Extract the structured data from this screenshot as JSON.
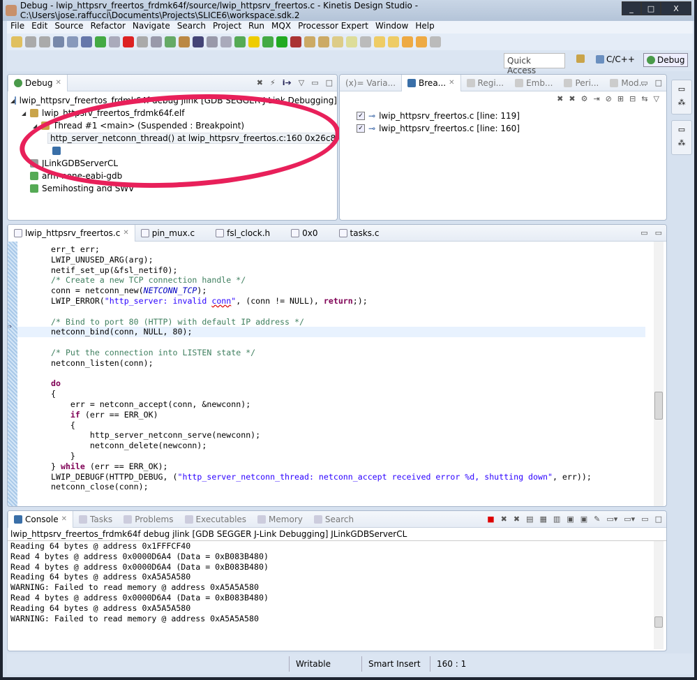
{
  "window": {
    "title": "Debug - lwip_httpsrv_freertos_frdmk64f/source/lwip_httpsrv_freertos.c - Kinetis Design Studio - C:\\Users\\jose.raffucci\\Documents\\Projects\\SLICE6\\workspace.sdk.2",
    "minimize": "_",
    "maximize": "□",
    "close": "X"
  },
  "menu": [
    "File",
    "Edit",
    "Source",
    "Refactor",
    "Navigate",
    "Search",
    "Project",
    "Run",
    "MQX",
    "Processor Expert",
    "Window",
    "Help"
  ],
  "quick_access": "Quick Access",
  "perspectives": {
    "cpp": "C/C++",
    "debug": "Debug"
  },
  "debug_view": {
    "tab": "Debug",
    "tree": [
      "lwip_httpsrv_freertos_frdmk64f debug jlink [GDB SEGGER J-Link Debugging]",
      "lwip_httpsrv_freertos_frdmk64f.elf",
      "Thread #1 <main> (Suspended : Breakpoint)",
      "http_server_netconn_thread() at lwip_httpsrv_freertos.c:160 0x26c8",
      "",
      "JLinkGDBServerCL",
      "arm-none-eabi-gdb",
      "Semihosting and SWV"
    ]
  },
  "right_view": {
    "tabs": [
      "(x)= Varia...",
      "Brea...",
      "Regi...",
      "Emb...",
      "Peri...",
      "Mod..."
    ],
    "breakpoints": [
      {
        "label": "lwip_httpsrv_freertos.c [line: 119]",
        "checked": true
      },
      {
        "label": "lwip_httpsrv_freertos.c [line: 160]",
        "checked": true
      }
    ]
  },
  "editor": {
    "tabs": [
      "lwip_httpsrv_freertos.c",
      "pin_mux.c",
      "fsl_clock.h",
      "0x0",
      "tasks.c"
    ],
    "current_line": 9,
    "lines": [
      [
        [
          "p",
          "err_t err;"
        ]
      ],
      [
        [
          "p",
          "LWIP_UNUSED_ARG(arg);"
        ]
      ],
      [
        [
          "p",
          "netif_set_up(&fsl_netif0);"
        ]
      ],
      [
        [
          "c",
          "/* Create a new TCP connection handle */"
        ]
      ],
      [
        [
          "p",
          "conn = netconn_new("
        ],
        [
          "n",
          "NETCONN_TCP"
        ],
        [
          "p",
          ");"
        ]
      ],
      [
        [
          "p",
          "LWIP_ERROR("
        ],
        [
          "s",
          "\"http_server: invalid "
        ],
        [
          "su",
          "conn"
        ],
        [
          "s",
          "\""
        ],
        [
          "p",
          ", (conn != NULL), "
        ],
        [
          "k",
          "return"
        ],
        [
          "p",
          ";);"
        ]
      ],
      [],
      [
        [
          "c",
          "/* Bind to port 80 (HTTP) with default IP address */"
        ]
      ],
      [
        [
          "p",
          "netconn_bind(conn, NULL, 80);"
        ]
      ],
      [],
      [
        [
          "c",
          "/* Put the connection into LISTEN state */"
        ]
      ],
      [
        [
          "p",
          "netconn_listen(conn);"
        ]
      ],
      [],
      [
        [
          "k",
          "do"
        ]
      ],
      [
        [
          "p",
          "{"
        ]
      ],
      [
        [
          "p",
          "    err = netconn_accept(conn, &newconn);"
        ]
      ],
      [
        [
          "p",
          "    "
        ],
        [
          "k",
          "if"
        ],
        [
          "p",
          " (err == ERR_OK)"
        ]
      ],
      [
        [
          "p",
          "    {"
        ]
      ],
      [
        [
          "p",
          "        http_server_netconn_serve(newconn);"
        ]
      ],
      [
        [
          "p",
          "        netconn_delete(newconn);"
        ]
      ],
      [
        [
          "p",
          "    }"
        ]
      ],
      [
        [
          "p",
          "} "
        ],
        [
          "k",
          "while"
        ],
        [
          "p",
          " (err == ERR_OK);"
        ]
      ],
      [
        [
          "p",
          "LWIP_DEBUGF(HTTPD_DEBUG, ("
        ],
        [
          "s",
          "\"http_server_netconn_thread: netconn_accept received error %d, shutting down\""
        ],
        [
          "p",
          ", err));"
        ]
      ],
      [
        [
          "p",
          "netconn_close(conn);"
        ]
      ]
    ]
  },
  "console": {
    "tabs": [
      "Console",
      "Tasks",
      "Problems",
      "Executables",
      "Memory",
      "Search"
    ],
    "header": "lwip_httpsrv_freertos_frdmk64f debug jlink [GDB SEGGER J-Link Debugging] JLinkGDBServerCL",
    "lines": [
      "Reading 64 bytes @ address 0x1FFFCF40",
      "Read 4 bytes @ address 0x0000D6A4 (Data = 0xB083B480)",
      "Read 4 bytes @ address 0x0000D6A4 (Data = 0xB083B480)",
      "Reading 64 bytes @ address 0xA5A5A580",
      "WARNING: Failed to read memory @ address 0xA5A5A580",
      "Read 4 bytes @ address 0x0000D6A4 (Data = 0xB083B480)",
      "Reading 64 bytes @ address 0xA5A5A580",
      "WARNING: Failed to read memory @ address 0xA5A5A580"
    ]
  },
  "status": {
    "mode": "Writable",
    "insert": "Smart Insert",
    "position": "160 : 1"
  },
  "colors": {
    "highlight_oval": "#e8205a",
    "keyword": "#7f0055",
    "comment": "#3f7f5f",
    "string": "#2a00ff",
    "current_line": "#e8f2fe"
  }
}
